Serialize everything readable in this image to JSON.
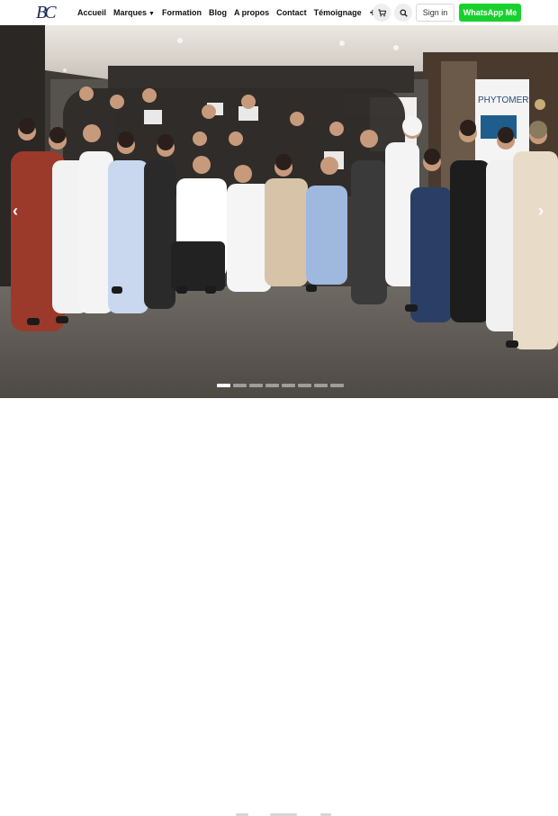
{
  "brand": {
    "logo_text": "BC"
  },
  "nav": {
    "items": [
      {
        "label": "Accueil",
        "dropdown": false
      },
      {
        "label": "Marques",
        "dropdown": true
      },
      {
        "label": "Formation",
        "dropdown": false
      },
      {
        "label": "Blog",
        "dropdown": false
      },
      {
        "label": "A propos",
        "dropdown": false
      },
      {
        "label": "Contact",
        "dropdown": false
      },
      {
        "label": "Témoignage",
        "dropdown": false
      }
    ],
    "more": "+"
  },
  "actions": {
    "cart_icon": "cart-icon",
    "search_icon": "search-icon",
    "signin_label": "Sign in",
    "whatsapp_label": "WhatsApp Me",
    "whatsapp_color": "#19d12e"
  },
  "hero": {
    "banner_text": "PHYTOMER",
    "prev_icon": "chevron-left-icon",
    "next_icon": "chevron-right-icon",
    "slide_count": 8,
    "active_slide": 1
  }
}
